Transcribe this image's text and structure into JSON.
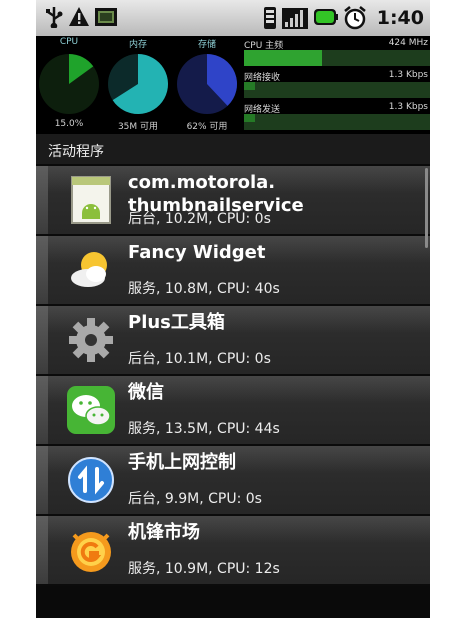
{
  "status_bar": {
    "time": "1:40",
    "icons": [
      "usb-icon",
      "warning-icon",
      "sd-card-icon",
      "vibrate-icon",
      "signal-icon",
      "battery-icon",
      "alarm-icon"
    ]
  },
  "monitor": {
    "gauges": [
      {
        "label": "CPU",
        "value": "15.0%",
        "fraction": 0.15,
        "color": "#1fa32b"
      },
      {
        "label": "内存",
        "value": "35M 可用",
        "fraction": 0.66,
        "color": "#23b3b3"
      },
      {
        "label": "存储",
        "value": "62% 可用",
        "fraction": 0.38,
        "color": "#2f44c8"
      }
    ],
    "bars": [
      {
        "label": "CPU 主频",
        "value": "424 MHz",
        "fraction": 0.42
      },
      {
        "label": "网络接收",
        "value": "1.3 Kbps",
        "fraction": 0.06
      },
      {
        "label": "网络发送",
        "value": "1.3 Kbps",
        "fraction": 0.06
      }
    ]
  },
  "section_title": "活动程序",
  "processes": [
    {
      "name": "com.motorola.\nthumbnailservice",
      "info": "后台, 10.2M, CPU: 0s",
      "icon": "android-icon"
    },
    {
      "name": "Fancy Widget",
      "info": "服务, 10.8M, CPU: 40s",
      "icon": "weather-icon"
    },
    {
      "name": "Plus工具箱",
      "info": "后台, 10.1M, CPU: 0s",
      "icon": "gear-icon"
    },
    {
      "name": "微信",
      "info": "服务, 13.5M, CPU: 44s",
      "icon": "wechat-icon"
    },
    {
      "name": "手机上网控制",
      "info": "后台, 9.9M, CPU: 0s",
      "icon": "data-toggle-icon"
    },
    {
      "name": "机锋市场",
      "info": "服务, 10.9M, CPU: 12s",
      "icon": "market-icon"
    }
  ]
}
